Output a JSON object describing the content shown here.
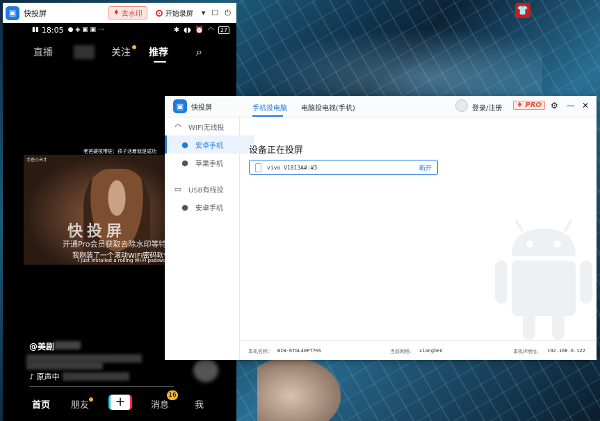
{
  "phone_window": {
    "title": "快投屏",
    "remove_watermark": "去水印",
    "start_recording": "开始录屏",
    "status_time": "18:05",
    "battery": "27",
    "tabs": {
      "live": "直播",
      "follow": "关注",
      "recommend": "推荐"
    },
    "video": {
      "corner_text": "老爸小天才",
      "caption_top": "老爸硬核带娃：孩子活着就是成功",
      "watermark": "快投屏",
      "promo": "开通Pro会员获取去除水印等特",
      "subtitle_cn": "我刚装了一个滚动WIFI密码软件",
      "subtitle_en": "I just installed a rolling Wi-Fi password."
    },
    "author_prefix": "@美剧",
    "music_prefix": "原声中",
    "bottom_nav": {
      "home": "首页",
      "friends": "朋友",
      "add": "+",
      "messages": "消息",
      "messages_badge": "16",
      "me": "我"
    }
  },
  "main_window": {
    "app_name": "快投屏",
    "tabs": {
      "phone_to_pc": "手机投电脑",
      "pc_to_tv": "电脑投电视(手机)"
    },
    "login": "登录/注册",
    "pro": "PRO",
    "sidebar": {
      "wifi_group": "WIFI无线投",
      "wifi_android": "安卓手机",
      "wifi_apple": "苹果手机",
      "usb_group": "USB有线投",
      "usb_android": "安卓手机"
    },
    "heading": "设备正在投屏",
    "device": {
      "name": "vivo V1813A#:#3",
      "action": "断开"
    },
    "footer": {
      "host_label": "本机名称:",
      "host_value": "WIN-6TGL40PT7HS",
      "network_label": "当前网络:",
      "network_value": "xiangben",
      "ip_label": "本机IP地址:",
      "ip_value": "192.168.0.122"
    }
  },
  "colors": {
    "accent": "#1f7ae0",
    "record_red": "#ee3333",
    "badge": "#f2b430"
  }
}
